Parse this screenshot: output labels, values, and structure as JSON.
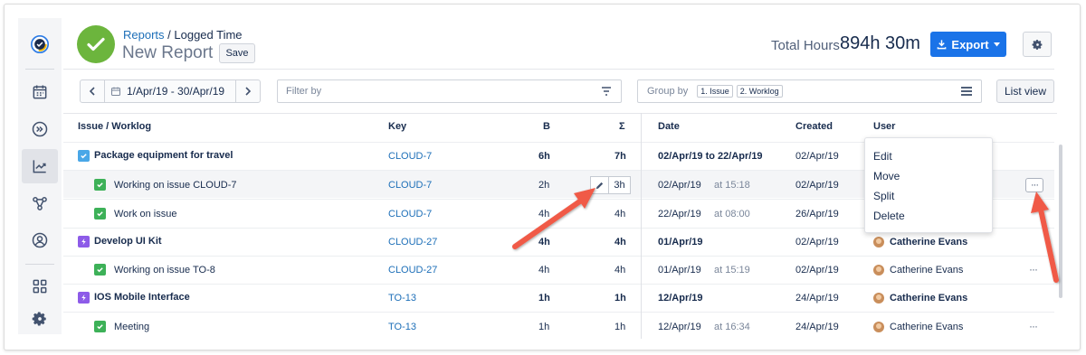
{
  "app": {
    "logo_icon": "app-logo-icon"
  },
  "sidebar": {
    "items": [
      {
        "icon": "calendar-icon"
      },
      {
        "icon": "forward-circle-icon"
      },
      {
        "icon": "chart-trend-icon",
        "active": true
      },
      {
        "icon": "nodes-icon"
      },
      {
        "icon": "user-circle-icon"
      },
      {
        "icon": "grid-icon"
      },
      {
        "icon": "gear-icon"
      }
    ]
  },
  "header": {
    "breadcrumb_link": "Reports",
    "breadcrumb_sep": " / ",
    "breadcrumb_current": "Logged Time",
    "title": "New Report",
    "save_label": "Save",
    "total_label": "Total Hours",
    "total_value": "894h 30m",
    "export_label": "Export",
    "colors": {
      "accent": "#1a73e8",
      "success": "#6cb53d"
    }
  },
  "toolbar": {
    "date_range": "1/Apr/19 - 30/Apr/19",
    "filter_placeholder": "Filter by",
    "group_label": "Group by",
    "group_chips": [
      "1. Issue",
      "2. Worklog"
    ],
    "list_view_label": "List view"
  },
  "table": {
    "headers": {
      "issue": "Issue / Worklog",
      "key": "Key",
      "b": "B",
      "sigma": "Σ",
      "date": "Date",
      "created": "Created",
      "user": "User"
    },
    "rows": [
      {
        "type": "issue",
        "icon": "blue",
        "name": "Package equipment for travel",
        "key": "CLOUD-7",
        "b": "6h",
        "sigma": "7h",
        "date": "02/Apr/19 to 22/Apr/19",
        "time": "",
        "created": "02/Apr/19",
        "user": ""
      },
      {
        "type": "worklog",
        "icon": "green",
        "name": "Working on issue CLOUD-7",
        "key": "CLOUD-7",
        "b": "2h",
        "sigma": "3h",
        "date": "02/Apr/19",
        "time": "at 15:18",
        "created": "02/Apr/19",
        "user": ""
      },
      {
        "type": "worklog",
        "icon": "green",
        "name": "Work on issue",
        "key": "CLOUD-7",
        "b": "4h",
        "sigma": "4h",
        "date": "22/Apr/19",
        "time": "at 08:00",
        "created": "26/Apr/19",
        "user": ""
      },
      {
        "type": "issue",
        "icon": "purple",
        "name": "Develop UI Kit",
        "key": "CLOUD-27",
        "b": "4h",
        "sigma": "4h",
        "date": "01/Apr/19",
        "time": "",
        "created": "02/Apr/19",
        "user": "Catherine Evans"
      },
      {
        "type": "worklog",
        "icon": "green",
        "name": "Working on issue TO-8",
        "key": "CLOUD-27",
        "b": "4h",
        "sigma": "4h",
        "date": "01/Apr/19",
        "time": "at 15:19",
        "created": "02/Apr/19",
        "user": "Catherine Evans"
      },
      {
        "type": "issue",
        "icon": "purple",
        "name": "IOS Mobile Interface",
        "key": "TO-13",
        "b": "1h",
        "sigma": "1h",
        "date": "12/Apr/19",
        "time": "",
        "created": "24/Apr/19",
        "user": "Catherine Evans"
      },
      {
        "type": "worklog",
        "icon": "green",
        "name": "Meeting",
        "key": "TO-13",
        "b": "1h",
        "sigma": "1h",
        "date": "12/Apr/19",
        "time": "at 16:34",
        "created": "24/Apr/19",
        "user": "Catherine Evans"
      }
    ]
  },
  "context_menu": {
    "items": [
      "Edit",
      "Move",
      "Split",
      "Delete"
    ]
  },
  "row_actions": {
    "more_label": "···"
  }
}
